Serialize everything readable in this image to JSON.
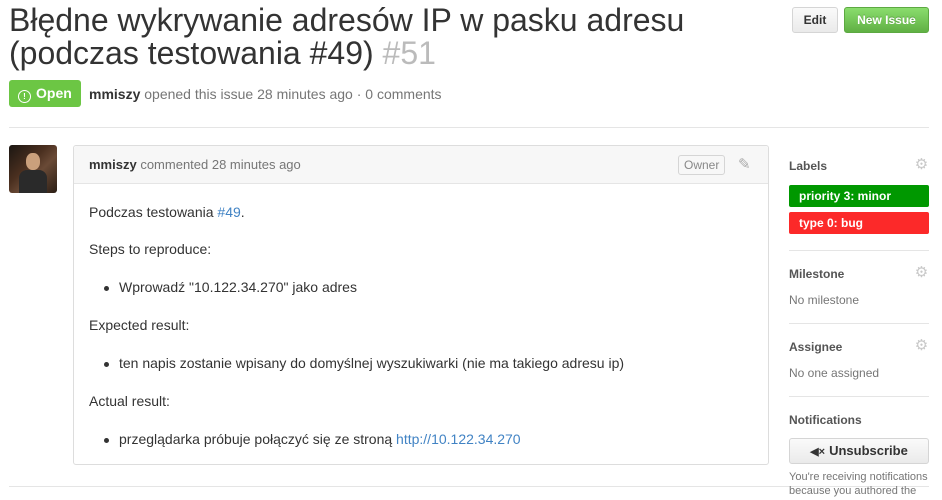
{
  "issue": {
    "title": "Błędne wykrywanie adresów IP w pasku adresu (podczas testowania #49)",
    "number": "#51",
    "state": "Open",
    "author": "mmiszy",
    "opened_text": "opened this issue 28 minutes ago · 0 comments"
  },
  "header_buttons": {
    "edit": "Edit",
    "new_issue": "New Issue"
  },
  "comment": {
    "author": "mmiszy",
    "meta": "commented 28 minutes ago",
    "role_badge": "Owner",
    "body": {
      "intro": "Podczas testowania",
      "intro_link": "#49",
      "intro_end": ".",
      "steps_heading": "Steps to reproduce:",
      "step_1": "Wprowadź \"10.122.34.270\" jako adres",
      "expected_heading": "Expected result:",
      "expected_1": "ten napis zostanie wpisany do domyślnej wyszukiwarki (nie ma takiego adresu ip)",
      "actual_heading": "Actual result:",
      "actual_1": "przeglądarka próbuje połączyć się ze stroną",
      "actual_link": "http://10.122.34.270"
    }
  },
  "sidebar": {
    "labels_title": "Labels",
    "labels": [
      {
        "name": "priority 3: minor",
        "color": "#009800"
      },
      {
        "name": "type 0: bug",
        "color": "#fc2929"
      }
    ],
    "milestone_title": "Milestone",
    "milestone_value": "No milestone",
    "assignee_title": "Assignee",
    "assignee_value": "No one assigned",
    "notifications_title": "Notifications",
    "unsubscribe_label": "Unsubscribe",
    "notifications_text": "You're receiving notifications because you authored the"
  },
  "colors": {
    "open_green": "#6cc644",
    "link_blue": "#4183c4"
  },
  "icons": {
    "state": "issue-opened-icon",
    "edit_comment": "pencil-icon",
    "settings": "gear-icon",
    "unsubscribe": "mute-icon"
  }
}
